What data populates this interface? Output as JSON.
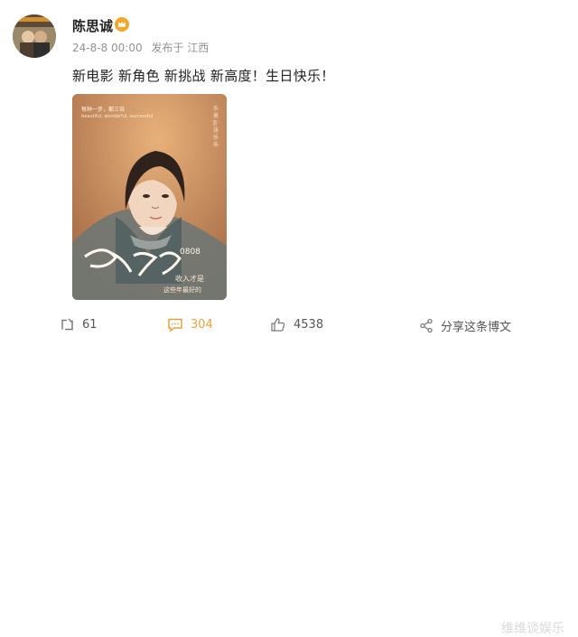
{
  "post": {
    "username": "陈思诚",
    "timestamp": "24-8-8 00:00",
    "source": "发布于 江西",
    "text": "新电影 新角色 新挑战 新高度！生日快乐！",
    "poster": {
      "small_line_1": "每种一步，都三倍",
      "small_line_2": "beautiful, wonderful, successful",
      "vertical_text": "乐美言·张乐乐",
      "handwriting": "生日快乐",
      "year": "0808",
      "bottom_note": "收入才是",
      "bottom_note_2": "这些年最好的"
    }
  },
  "actions": {
    "repost": "61",
    "comment": "304",
    "like": "4538",
    "share": "分享这条博文"
  },
  "watermark": "维维谈娱乐"
}
